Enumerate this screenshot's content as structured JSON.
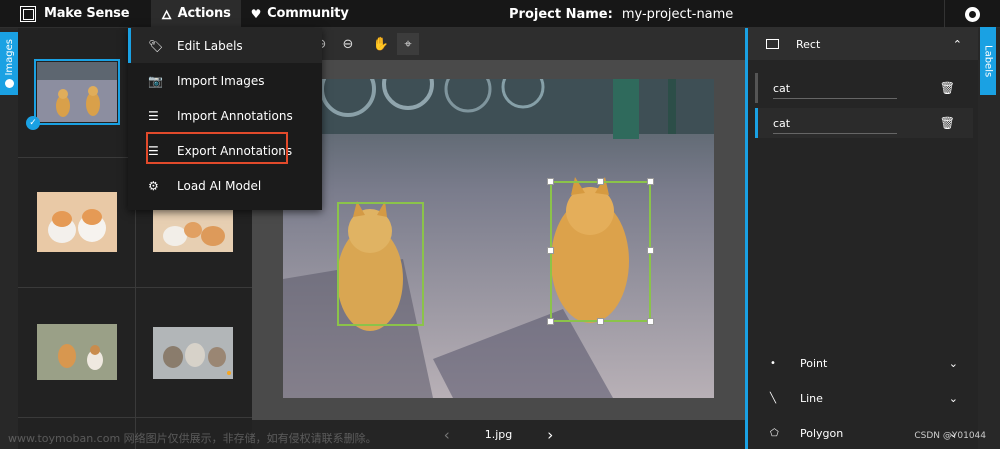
{
  "app": {
    "logo_text": "Make Sense"
  },
  "top_menu": {
    "actions_label": "Actions",
    "community_label": "Community"
  },
  "project": {
    "label": "Project Name:",
    "value": "my-project-name"
  },
  "side_tabs": {
    "left": "Images",
    "right": "Labels"
  },
  "dropdown": {
    "items": [
      {
        "label": "Edit Labels",
        "icon": "label-icon"
      },
      {
        "label": "Import Images",
        "icon": "camera-icon"
      },
      {
        "label": "Import Annotations",
        "icon": "import-list-icon"
      },
      {
        "label": "Export Annotations",
        "icon": "export-list-icon"
      },
      {
        "label": "Load AI Model",
        "icon": "ai-model-icon"
      }
    ]
  },
  "canvas": {
    "file_name": "1.jpg"
  },
  "right_panel": {
    "header": "Rect",
    "labels": [
      "cat",
      "cat"
    ],
    "tools": [
      "Point",
      "Line",
      "Polygon"
    ]
  },
  "watermark": {
    "left": "www.toymoban.com 网络图片仅供展示，非存储，如有侵权请联系删除。",
    "right": "CSDN @Y01044"
  },
  "colors": {
    "accent": "#1aa1e3",
    "bbox": "#8bc34a",
    "highlight": "#e24a2b"
  }
}
